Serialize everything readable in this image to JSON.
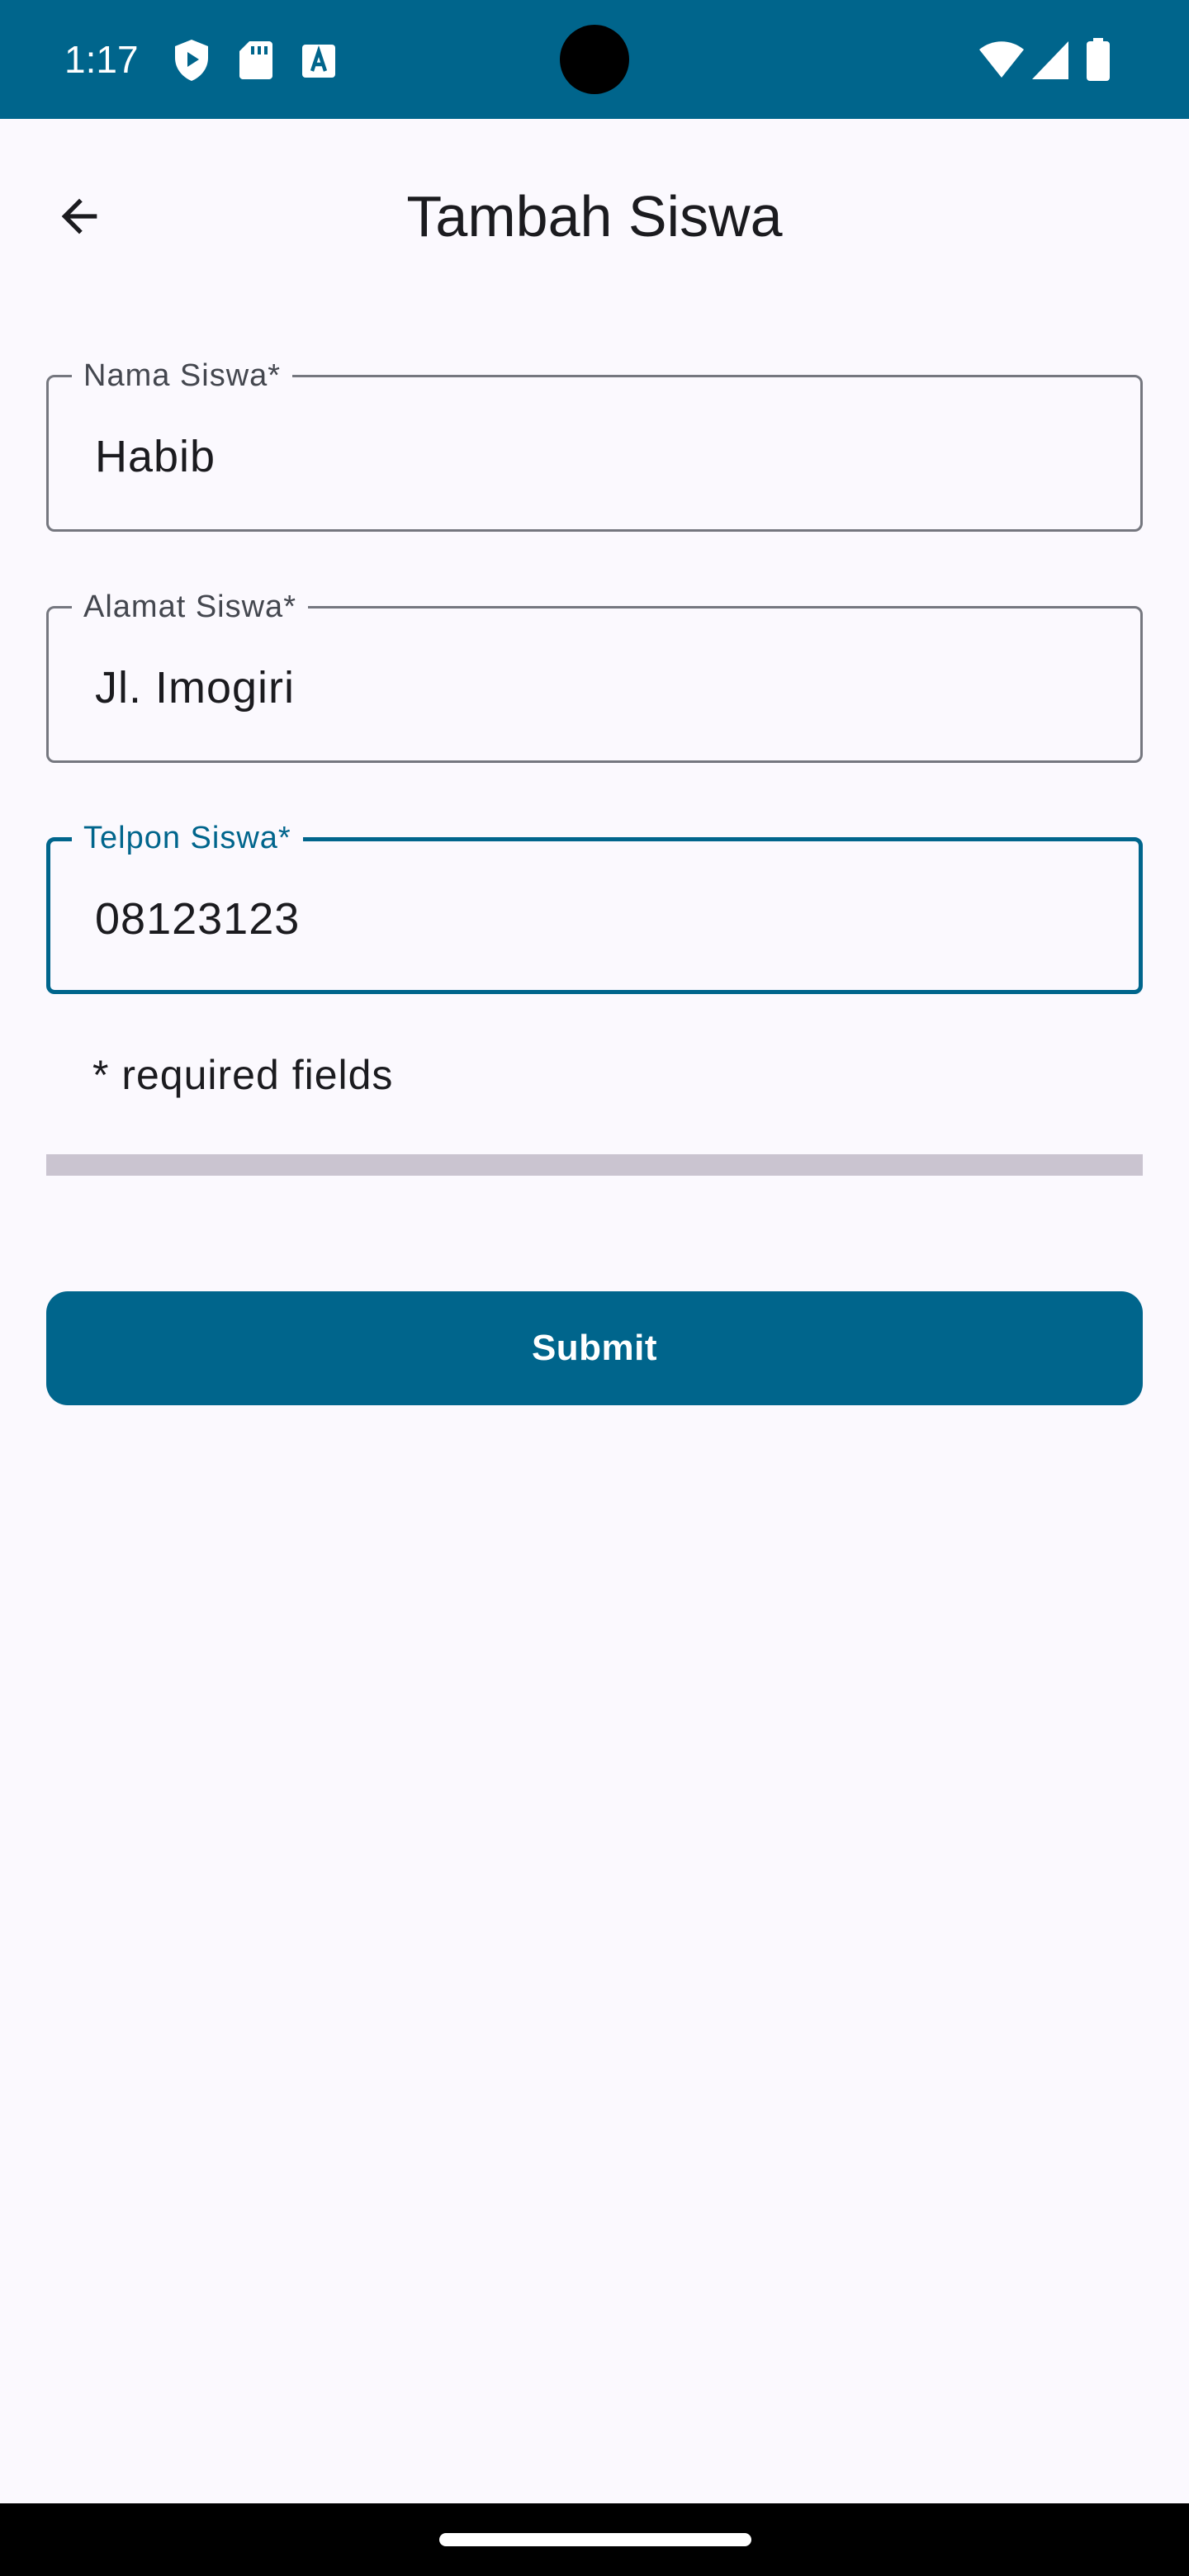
{
  "status_bar": {
    "time": "1:17",
    "icons": [
      "shield-play-icon",
      "sd-card-icon",
      "font-a-icon",
      "wifi-icon",
      "cellular-signal-icon",
      "battery-icon"
    ],
    "background": "#00658c"
  },
  "app_bar": {
    "title": "Tambah Siswa",
    "back_icon": "arrow-back-icon"
  },
  "form": {
    "fields": [
      {
        "label": "Nama Siswa*",
        "value": "Habib",
        "focused": false
      },
      {
        "label": "Alamat Siswa*",
        "value": "Jl. Imogiri",
        "focused": false
      },
      {
        "label": "Telpon Siswa*",
        "value": "08123123",
        "focused": true
      }
    ],
    "required_note": "* required fields",
    "progress": 0,
    "submit_label": "Submit"
  },
  "colors": {
    "accent": "#00658c",
    "background": "#fbf9fe",
    "outline": "#75777f",
    "track": "#cac4d0"
  }
}
